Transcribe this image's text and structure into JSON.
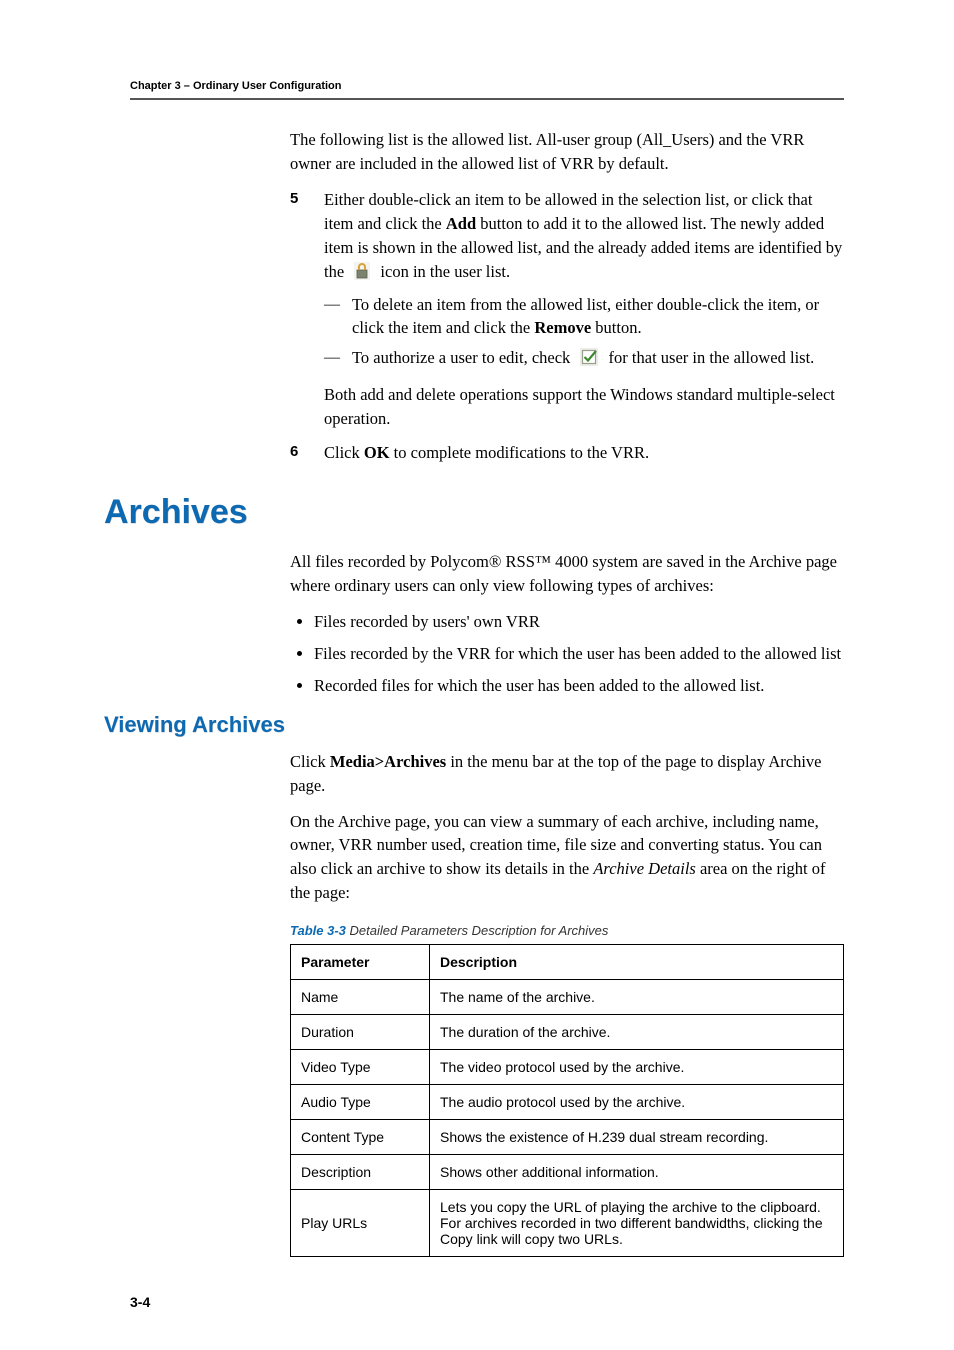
{
  "header": {
    "chapter_line": "Chapter 3 – Ordinary User Configuration"
  },
  "intro_para": "The following list is the allowed list. All-user group (All_Users) and the VRR owner are included in the allowed list of VRR by default.",
  "step5": {
    "num": "5",
    "part_a": "Either double-click an item to be allowed in the selection list, or click that item and click the ",
    "add_bold": "Add",
    "part_b": " button to add it to the allowed list. The newly added item is shown in the allowed list, and the already added items are identified by the ",
    "part_c": " icon in the user list.",
    "sub1a": "To delete an item from the allowed list, either double-click the item, or click the item and click the ",
    "remove_bold": "Remove",
    "sub1b": " button.",
    "sub2a": "To authorize a user to edit, check ",
    "sub2b": " for that user in the allowed list.",
    "tail": "Both add and delete operations support the Windows standard multiple-select operation."
  },
  "step6": {
    "num": "6",
    "a": "Click ",
    "ok_bold": "OK",
    "b": " to complete modifications to the VRR."
  },
  "archives": {
    "title": "Archives",
    "intro": "All files recorded by Polycom® RSS™ 4000 system are saved in the Archive page where ordinary users can only view following types of archives:",
    "bullets": [
      "Files recorded by users' own VRR",
      "Files recorded by the VRR for which the user has been added to the allowed list",
      "Recorded files for which the user has been added to the allowed list."
    ]
  },
  "viewing": {
    "title": "Viewing Archives",
    "p1a": "Click ",
    "p1bold": "Media>Archives",
    "p1b": " in the menu bar at the top of the page to display Archive page.",
    "p2a": "On the Archive page, you can view a summary of each archive, including name, owner, VRR number used, creation time, file size and converting status. You can also click an archive to show its details in the ",
    "p2i": "Archive Details",
    "p2b": " area on the right of the page:"
  },
  "table": {
    "caption_bold": "Table 3-3",
    "caption_rest": " Detailed Parameters Description for Archives",
    "head_param": "Parameter",
    "head_desc": "Description",
    "rows": [
      {
        "param": "Name",
        "desc": "The name of the archive."
      },
      {
        "param": "Duration",
        "desc": "The duration of the archive."
      },
      {
        "param": "Video Type",
        "desc": "The video protocol used by the archive."
      },
      {
        "param": "Audio Type",
        "desc": "The audio protocol used by the archive."
      },
      {
        "param": "Content Type",
        "desc": "Shows the existence of H.239 dual stream recording."
      },
      {
        "param": "Description",
        "desc": "Shows other additional information."
      },
      {
        "param": "Play URLs",
        "desc": "Lets you copy the URL of playing the archive to the clipboard. For archives recorded in two different bandwidths, clicking the Copy link will copy two URLs."
      }
    ]
  },
  "footer": {
    "pagenum": "3-4"
  }
}
